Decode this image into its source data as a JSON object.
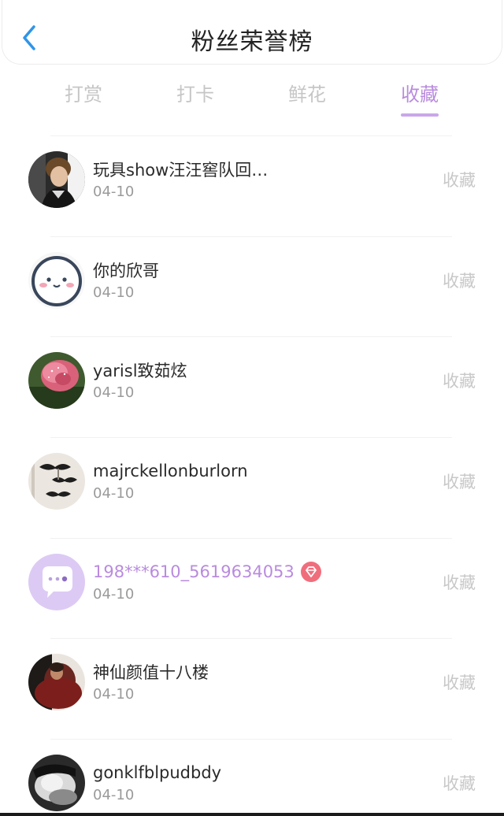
{
  "header": {
    "title": "粉丝荣誉榜"
  },
  "tabs": [
    {
      "label": "打赏",
      "active": false
    },
    {
      "label": "打卡",
      "active": false
    },
    {
      "label": "鲜花",
      "active": false
    },
    {
      "label": "收藏",
      "active": true
    }
  ],
  "colors": {
    "accent": "#b98bde",
    "tab_underline": "#c9a7ea",
    "inactive_text": "#c6c6c6",
    "vip_gem": "#f06e7c"
  },
  "list": [
    {
      "name": "玩具show汪汪窖队回…",
      "date": "04-10",
      "action": "收藏",
      "avatar": "person-photo-avatar",
      "vip": false
    },
    {
      "name": "你的欣哥",
      "date": "04-10",
      "action": "收藏",
      "avatar": "cartoon-face-avatar",
      "vip": false
    },
    {
      "name": "yarisl致茹炫",
      "date": "04-10",
      "action": "收藏",
      "avatar": "flower-photo-avatar",
      "vip": false
    },
    {
      "name": "majrckellonburlorn",
      "date": "04-10",
      "action": "收藏",
      "avatar": "mustache-avatar",
      "vip": false
    },
    {
      "name": "198***610_5619634053",
      "date": "04-10",
      "action": "收藏",
      "avatar": "default-chat-bubble-avatar",
      "vip": true,
      "badge": "diamond-icon"
    },
    {
      "name": "神仙颜值十八楼",
      "date": "04-10",
      "action": "收藏",
      "avatar": "dark-photo-avatar",
      "vip": false
    },
    {
      "name": "gonklfblpudbdy",
      "date": "04-10",
      "action": "收藏",
      "avatar": "bw-photo-avatar",
      "vip": false
    }
  ]
}
